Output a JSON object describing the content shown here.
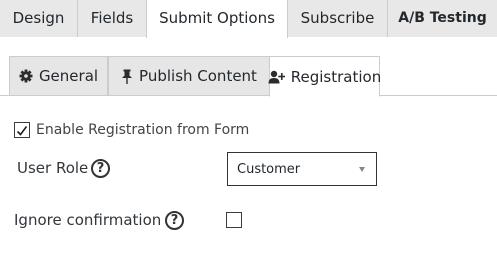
{
  "top_tabs": [
    {
      "label": "Design",
      "active": false
    },
    {
      "label": "Fields",
      "active": false
    },
    {
      "label": "Submit Options",
      "active": true
    },
    {
      "label": "Subscribe",
      "active": false
    },
    {
      "label": "A/B Testing",
      "active": false
    }
  ],
  "sub_tabs": [
    {
      "label": "General",
      "icon": "gear-icon",
      "active": false
    },
    {
      "label": "Publish Content",
      "icon": "pushpin-icon",
      "active": false
    },
    {
      "label": "Registration",
      "icon": "user-plus-icon",
      "active": true
    }
  ],
  "form": {
    "enable_registration": {
      "label": "Enable Registration from Form",
      "checked": true
    },
    "user_role": {
      "label": "User Role",
      "help_glyph": "?",
      "selected_value": "Customer"
    },
    "ignore_confirmation": {
      "label": "Ignore confirmation",
      "help_glyph": "?",
      "checked": false
    }
  },
  "colors": {
    "tab_bg": "#e8e8e8",
    "active_tab_bg": "#ffffff",
    "border": "#cccccc",
    "text": "#32373c"
  }
}
